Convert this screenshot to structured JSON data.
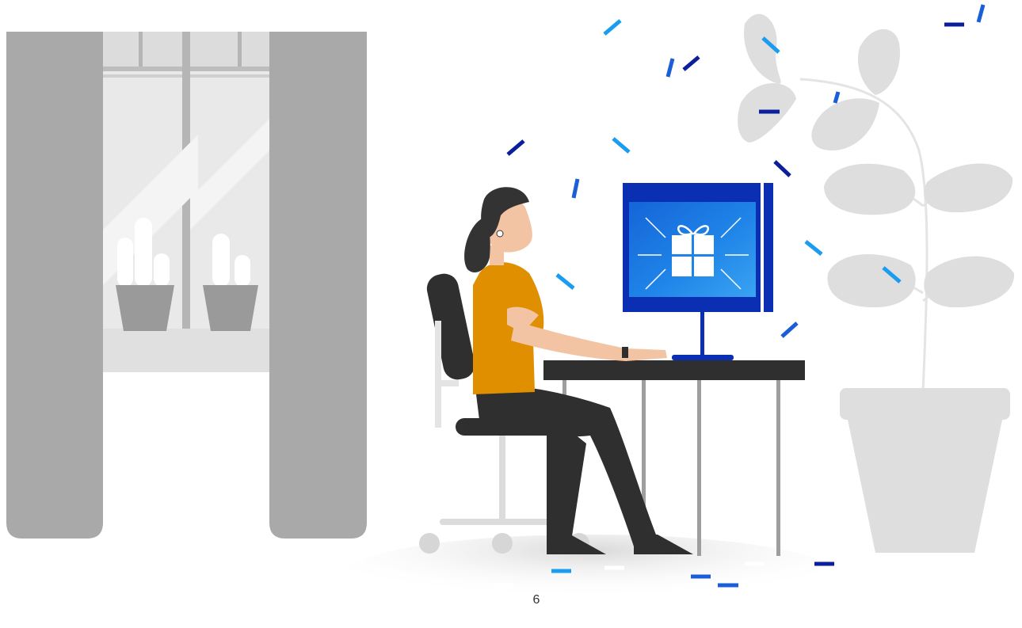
{
  "illustration": {
    "icons": {
      "window": "window-icon",
      "curtains": "curtain-icon",
      "cactus": "cactus-icon",
      "person": "person-icon",
      "chair": "office-chair-icon",
      "desk": "desk-icon",
      "monitor": "monitor-icon",
      "gift": "gift-icon",
      "plant": "potted-plant-icon",
      "confetti": "confetti-icon"
    },
    "colors": {
      "curtain": "#a9a9a9",
      "window_glass": "#e6e6e6",
      "plant": "#dedede",
      "shirt": "#e08f00",
      "skin": "#f2c4a3",
      "hair": "#333333",
      "monitor_frame": "#0a2fb3",
      "screen": "#1e7fe0",
      "confetti_dark": "#0b1f9c",
      "confetti_light": "#1a9cf0"
    }
  },
  "footer": {
    "page_number": "6"
  }
}
